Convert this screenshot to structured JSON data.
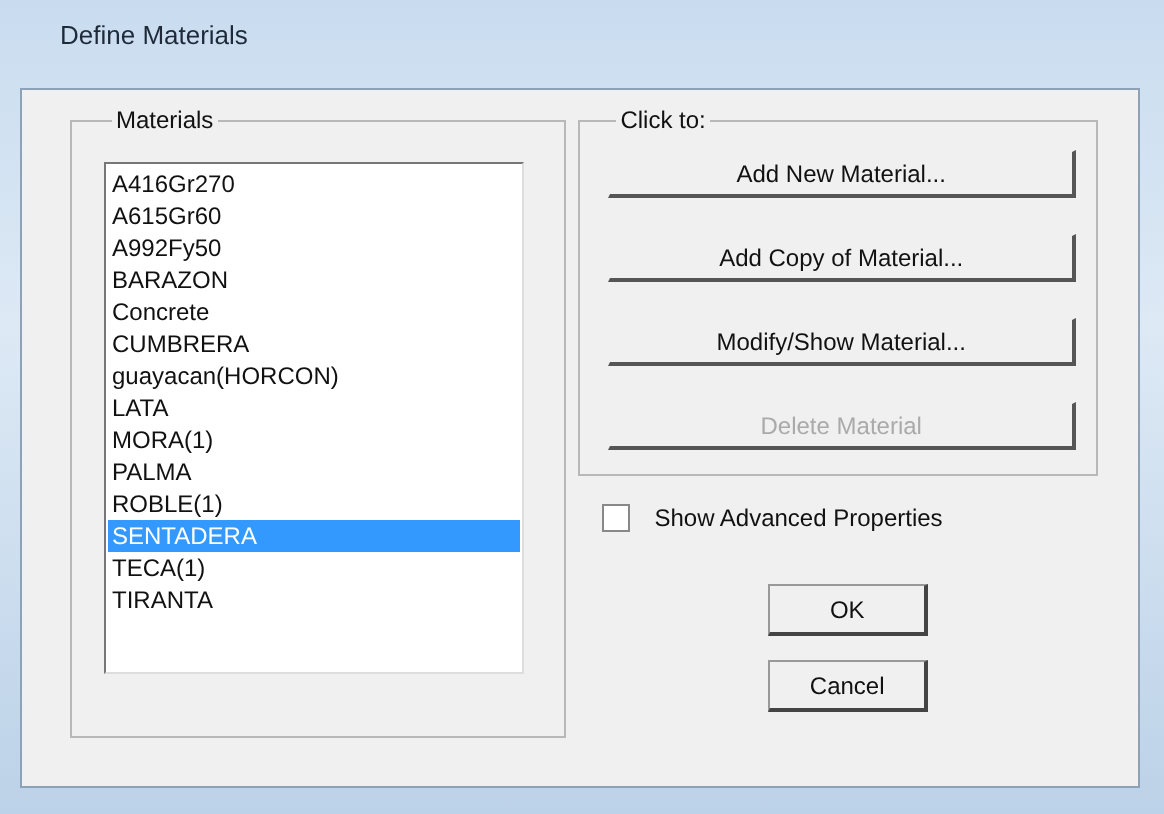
{
  "window": {
    "title": "Define Materials"
  },
  "materials": {
    "label": "Materials",
    "items": [
      {
        "name": "A416Gr270",
        "selected": false
      },
      {
        "name": "A615Gr60",
        "selected": false
      },
      {
        "name": "A992Fy50",
        "selected": false
      },
      {
        "name": "BARAZON",
        "selected": false
      },
      {
        "name": "Concrete",
        "selected": false
      },
      {
        "name": "CUMBRERA",
        "selected": false
      },
      {
        "name": "guayacan(HORCON)",
        "selected": false
      },
      {
        "name": "LATA",
        "selected": false
      },
      {
        "name": "MORA(1)",
        "selected": false
      },
      {
        "name": "PALMA",
        "selected": false
      },
      {
        "name": "ROBLE(1)",
        "selected": false
      },
      {
        "name": "SENTADERA",
        "selected": true
      },
      {
        "name": "TECA(1)",
        "selected": false
      },
      {
        "name": "TIRANTA",
        "selected": false
      }
    ]
  },
  "click_to": {
    "label": "Click to:",
    "buttons": [
      {
        "label": "Add New Material...",
        "disabled": false
      },
      {
        "label": "Add Copy of Material...",
        "disabled": false
      },
      {
        "label": "Modify/Show Material...",
        "disabled": false
      },
      {
        "label": "Delete Material",
        "disabled": true
      }
    ]
  },
  "show_advanced": {
    "label": "Show Advanced Properties",
    "checked": false
  },
  "buttons": [
    "OK",
    "Cancel"
  ]
}
